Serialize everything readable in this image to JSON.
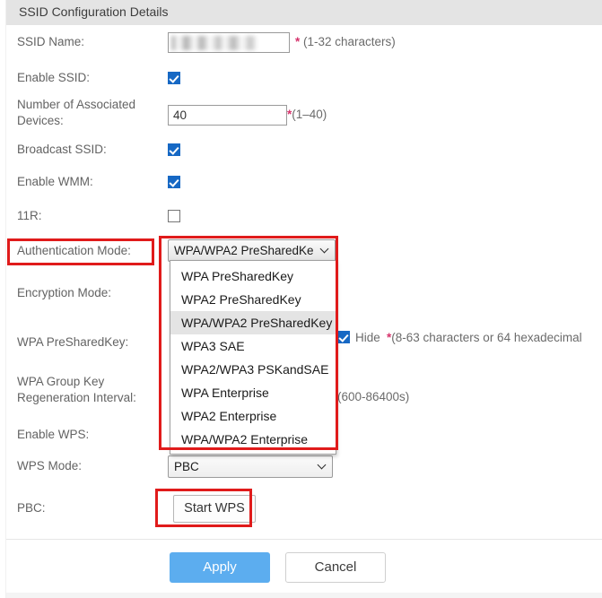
{
  "header": {
    "title": "SSID Configuration Details"
  },
  "form": {
    "ssid_name": {
      "label": "SSID Name:",
      "value": "",
      "redacted": true,
      "hint_star": "*",
      "hint": " (1-32 characters)"
    },
    "enable_ssid": {
      "label": "Enable SSID:",
      "checked": true
    },
    "num_devices": {
      "label": "Number of Associated\nDevices:",
      "value": "40",
      "hint_star": "*",
      "hint": "(1–40)"
    },
    "broadcast_ssid": {
      "label": "Broadcast SSID:",
      "checked": true
    },
    "enable_wmm": {
      "label": "Enable WMM:",
      "checked": true
    },
    "eleven_r": {
      "label": "11R:",
      "checked": false
    },
    "auth_mode": {
      "label": "Authentication Mode:",
      "selected": "WPA/WPA2 PreSharedKe",
      "selected_full": "WPA/WPA2 PreSharedKey",
      "expanded": true,
      "options": [
        "WPA PreSharedKey",
        "WPA2 PreSharedKey",
        "WPA/WPA2 PreSharedKey",
        "WPA3 SAE",
        "WPA2/WPA3 PSKandSAE",
        "WPA Enterprise",
        "WPA2 Enterprise",
        "WPA/WPA2 Enterprise"
      ],
      "highlighted_index": 2
    },
    "encryption_mode": {
      "label": "Encryption Mode:"
    },
    "wpa_psk": {
      "label": "WPA PreSharedKey:",
      "hide_checked": true,
      "hide_label": "Hide",
      "hint_star": "*",
      "hint": "(8-63 characters or 64 hexadecimal"
    },
    "wpa_group_key": {
      "label": "WPA Group Key\nRegeneration Interval:",
      "hint": "(600-86400s)"
    },
    "enable_wps": {
      "label": "Enable WPS:"
    },
    "wps_mode": {
      "label": "WPS Mode:",
      "selected": "PBC"
    },
    "pbc": {
      "label": "PBC:",
      "button_label": "Start WPS"
    }
  },
  "footer": {
    "apply_label": "Apply",
    "cancel_label": "Cancel"
  },
  "colors": {
    "header_bg": "#e4e4e4",
    "accent_blue": "#5cadef",
    "checkbox_blue": "#1668c4",
    "required_star": "#d6336c",
    "annotation_red": "#e01b1b",
    "highlight_gray": "#e4e4e4"
  },
  "annotations": {
    "boxes": [
      "authentication-mode-label",
      "authentication-mode-dropdown",
      "start-wps-button"
    ]
  }
}
